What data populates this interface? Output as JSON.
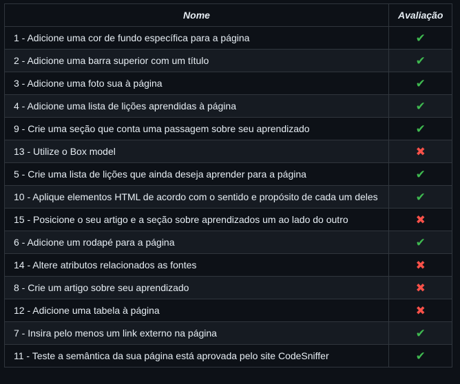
{
  "table": {
    "headers": {
      "name": "Nome",
      "evaluation": "Avaliação"
    },
    "rows": [
      {
        "name": "1 - Adicione uma cor de fundo específica para a página",
        "status": "pass",
        "symbol": "✔"
      },
      {
        "name": "2 - Adicione uma barra superior com um título",
        "status": "pass",
        "symbol": "✔"
      },
      {
        "name": "3 - Adicione uma foto sua à página",
        "status": "pass",
        "symbol": "✔"
      },
      {
        "name": "4 - Adicione uma lista de lições aprendidas à página",
        "status": "pass",
        "symbol": "✔"
      },
      {
        "name": "9 - Crie uma seção que conta uma passagem sobre seu aprendizado",
        "status": "pass",
        "symbol": "✔"
      },
      {
        "name": "13 - Utilize o Box model",
        "status": "fail",
        "symbol": "✖"
      },
      {
        "name": "5 - Crie uma lista de lições que ainda deseja aprender para a página",
        "status": "pass",
        "symbol": "✔"
      },
      {
        "name": "10 - Aplique elementos HTML de acordo com o sentido e propósito de cada um deles",
        "status": "pass",
        "symbol": "✔"
      },
      {
        "name": "15 - Posicione o seu artigo e a seção sobre aprendizados um ao lado do outro",
        "status": "fail",
        "symbol": "✖"
      },
      {
        "name": "6 - Adicione um rodapé para a página",
        "status": "pass",
        "symbol": "✔"
      },
      {
        "name": "14 - Altere atributos relacionados as fontes",
        "status": "fail",
        "symbol": "✖"
      },
      {
        "name": "8 - Crie um artigo sobre seu aprendizado",
        "status": "fail",
        "symbol": "✖"
      },
      {
        "name": "12 - Adicione uma tabela à página",
        "status": "fail",
        "symbol": "✖"
      },
      {
        "name": "7 - Insira pelo menos um link externo na página",
        "status": "pass",
        "symbol": "✔"
      },
      {
        "name": "11 - Teste a semântica da sua página está aprovada pelo site CodeSniffer",
        "status": "pass",
        "symbol": "✔"
      }
    ]
  },
  "colors": {
    "background": "#0d1117",
    "row_alt": "#161b22",
    "border": "#30363d",
    "pass": "#3fb950",
    "fail": "#f85149"
  }
}
